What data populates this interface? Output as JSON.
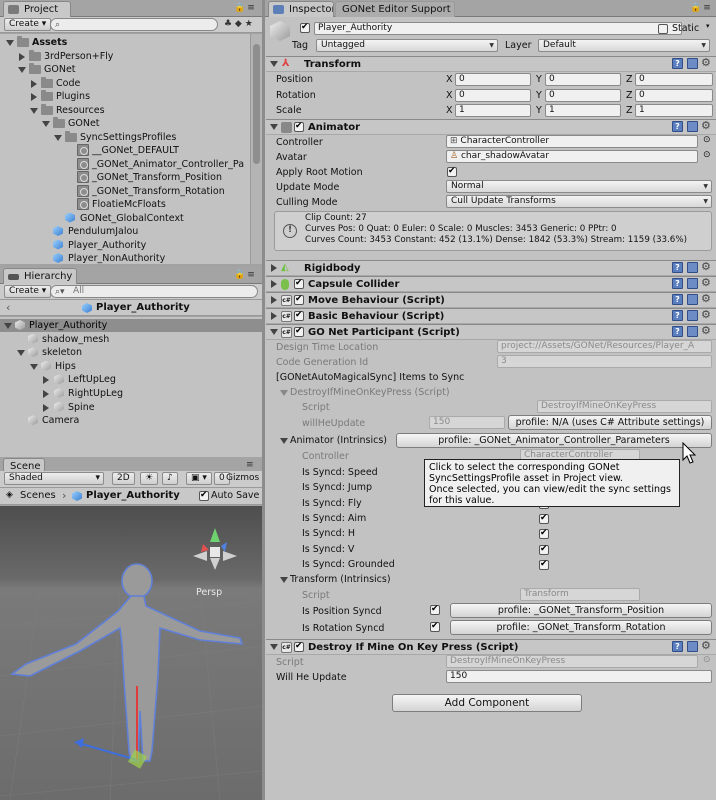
{
  "project": {
    "tab_label": "Project",
    "create_label": "Create",
    "tree": [
      {
        "label": "Assets",
        "depth": 0,
        "kind": "folder",
        "bold": true
      },
      {
        "label": "3rdPerson+Fly",
        "depth": 1,
        "kind": "folder"
      },
      {
        "label": "GONet",
        "depth": 1,
        "kind": "folder"
      },
      {
        "label": "Code",
        "depth": 2,
        "kind": "folder"
      },
      {
        "label": "Plugins",
        "depth": 2,
        "kind": "folder"
      },
      {
        "label": "Resources",
        "depth": 2,
        "kind": "folder"
      },
      {
        "label": "GONet",
        "depth": 3,
        "kind": "folder"
      },
      {
        "label": "SyncSettingsProfiles",
        "depth": 4,
        "kind": "folder"
      },
      {
        "label": "__GONet_DEFAULT",
        "depth": 5,
        "kind": "asset"
      },
      {
        "label": "_GONet_Animator_Controller_Pa",
        "depth": 5,
        "kind": "asset"
      },
      {
        "label": "_GONet_Transform_Position",
        "depth": 5,
        "kind": "asset"
      },
      {
        "label": "_GONet_Transform_Rotation",
        "depth": 5,
        "kind": "asset"
      },
      {
        "label": "FloatieMcFloats",
        "depth": 5,
        "kind": "asset"
      },
      {
        "label": "GONet_GlobalContext",
        "depth": 4,
        "kind": "prefab"
      },
      {
        "label": "PendulumJalou",
        "depth": 3,
        "kind": "prefab"
      },
      {
        "label": "Player_Authority",
        "depth": 3,
        "kind": "prefab"
      },
      {
        "label": "Player_NonAuthority",
        "depth": 3,
        "kind": "prefab"
      }
    ]
  },
  "hierarchy": {
    "tab_label": "Hierarchy",
    "create_label": "Create",
    "search_placeholder": "All",
    "breadcrumb": "Player_Authority",
    "tree": [
      {
        "label": "Player_Authority",
        "depth": 0,
        "selected": true
      },
      {
        "label": "shadow_mesh",
        "depth": 1
      },
      {
        "label": "skeleton",
        "depth": 1
      },
      {
        "label": "Hips",
        "depth": 2
      },
      {
        "label": "LeftUpLeg",
        "depth": 3
      },
      {
        "label": "RightUpLeg",
        "depth": 3
      },
      {
        "label": "Spine",
        "depth": 3
      },
      {
        "label": "Camera",
        "depth": 1
      }
    ]
  },
  "scene": {
    "tab_label": "Scene",
    "shading": "Shaded",
    "mode_2d": "2D",
    "gizmos": "Gizmos",
    "breadcrumb_root": "Scenes",
    "breadcrumb_current": "Player_Authority",
    "auto_save": "Auto Save",
    "persp": "Persp"
  },
  "inspector": {
    "tab_label": "Inspector",
    "tab2_label": "GONet Editor Support",
    "object_name": "Player_Authority",
    "static_label": "Static",
    "tag_label": "Tag",
    "tag_value": "Untagged",
    "layer_label": "Layer",
    "layer_value": "Default",
    "transform": {
      "title": "Transform",
      "rows": [
        {
          "label": "Position",
          "x": "0",
          "y": "0",
          "z": "0"
        },
        {
          "label": "Rotation",
          "x": "0",
          "y": "0",
          "z": "0"
        },
        {
          "label": "Scale",
          "x": "1",
          "y": "1",
          "z": "1"
        }
      ],
      "axis_x": "X",
      "axis_y": "Y",
      "axis_z": "Z"
    },
    "animator": {
      "title": "Animator",
      "controller_label": "Controller",
      "controller_value": "CharacterController",
      "avatar_label": "Avatar",
      "avatar_value": "char_shadowAvatar",
      "root_motion_label": "Apply Root Motion",
      "update_mode_label": "Update Mode",
      "update_mode_value": "Normal",
      "culling_label": "Culling Mode",
      "culling_value": "Cull Update Transforms",
      "info_line1": "Clip Count: 27",
      "info_line2": "Curves Pos: 0 Quat: 0 Euler: 0 Scale: 0 Muscles: 3453 Generic: 0 PPtr: 0",
      "info_line3": "Curves Count: 3453 Constant: 452 (13.1%) Dense: 1842 (53.3%) Stream: 1159 (33.6%)"
    },
    "rigidbody_title": "Rigidbody",
    "capsule_title": "Capsule Collider",
    "move_title": "Move Behaviour (Script)",
    "basic_title": "Basic Behaviour (Script)",
    "gonet": {
      "title": "GO Net Participant (Script)",
      "design_label": "Design Time Location",
      "design_value": "project://Assets/GONet/Resources/Player_A",
      "codegen_label": "Code Generation Id",
      "codegen_value": "3",
      "items_label": "[GONetAutoMagicalSync] Items to Sync",
      "destroy_group": "DestroyIfMineOnKeyPress (Script)",
      "script_label": "Script",
      "script_value": "DestroyIfMineOnKeyPress",
      "willhe_label": "willHeUpdate",
      "willhe_value": "150",
      "willhe_profile": "profile: N/A (uses C# Attribute settings)",
      "animator_group": "Animator (Intrinsics)",
      "animator_profile": "profile: _GONet_Animator_Controller_Parameters",
      "controller_label": "Controller",
      "controller_value": "CharacterController",
      "synced": [
        {
          "label": "Is Syncd: Speed",
          "checked": true
        },
        {
          "label": "Is Syncd: Jump",
          "checked": true
        },
        {
          "label": "Is Syncd: Fly",
          "checked": true
        },
        {
          "label": "Is Syncd: Aim",
          "checked": true
        },
        {
          "label": "Is Syncd: H",
          "checked": true
        },
        {
          "label": "Is Syncd: V",
          "checked": true
        },
        {
          "label": "Is Syncd: Grounded",
          "checked": true
        }
      ],
      "transform_group": "Transform (Intrinsics)",
      "transform_script_label": "Script",
      "transform_script_value": "Transform",
      "pos_label": "Is Position Syncd",
      "pos_profile": "profile: _GONet_Transform_Position",
      "rot_label": "Is Rotation Syncd",
      "rot_profile": "profile: _GONet_Transform_Rotation"
    },
    "tooltip": {
      "line1": "Click to select the corresponding GONet",
      "line2": "SyncSettingsProfile asset in Project view.",
      "line3": "Once selected, you can view/edit the sync settings",
      "line4": "for this value."
    },
    "destroy": {
      "title": "Destroy If Mine On Key Press (Script)",
      "script_label": "Script",
      "script_value": "DestroyIfMineOnKeyPress",
      "will_label": "Will He Update",
      "will_value": "150"
    },
    "add_component": "Add Component"
  },
  "colors": {
    "panel_bg": "#c2c2c2",
    "selection": "#8e8e8e",
    "scene_sky_top": "#5a5a5a",
    "scene_floor": "#6b6b6b",
    "prefab_blue": "#3c7fd0"
  }
}
